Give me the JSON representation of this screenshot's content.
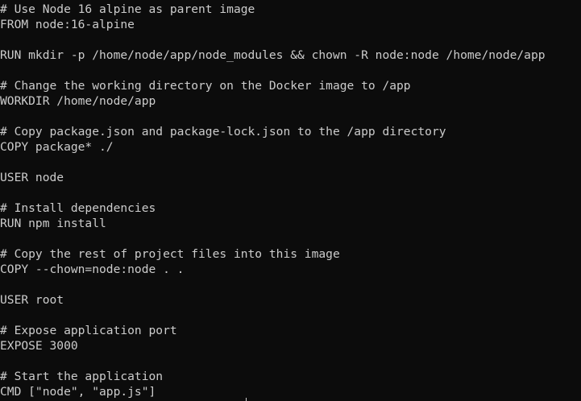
{
  "terminal": {
    "lines": [
      "# Use Node 16 alpine as parent image",
      "FROM node:16-alpine",
      "",
      "RUN mkdir -p /home/node/app/node_modules && chown -R node:node /home/node/app",
      "",
      "# Change the working directory on the Docker image to /app",
      "WORKDIR /home/node/app",
      "",
      "# Copy package.json and package-lock.json to the /app directory",
      "COPY package* ./",
      "",
      "USER node",
      "",
      "# Install dependencies",
      "RUN npm install",
      "",
      "# Copy the rest of project files into this image",
      "COPY --chown=node:node . .",
      "",
      "USER root",
      "",
      "# Expose application port",
      "EXPOSE 3000",
      "",
      "# Start the application",
      "CMD [\"node\", \"app.js\"]"
    ]
  },
  "colors": {
    "background": "#0c0c0c",
    "text": "#cccccc",
    "prompt_remnant_green": "#13a10e",
    "prompt_remnant_blue": "#3b78ff"
  }
}
